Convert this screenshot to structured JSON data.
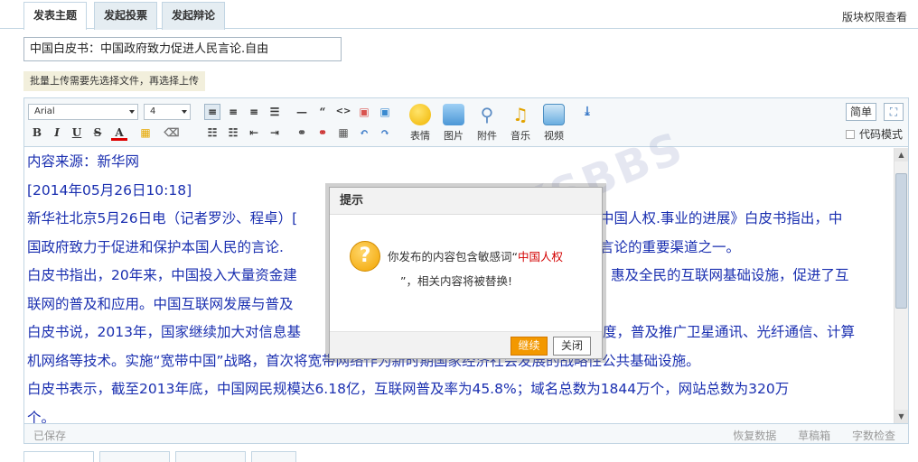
{
  "tabs": [
    {
      "label": "发表主题",
      "active": true
    },
    {
      "label": "发起投票",
      "active": false
    },
    {
      "label": "发起辩论",
      "active": false
    }
  ],
  "perm_link": "版块权限查看",
  "subject": {
    "value": "中国白皮书：中国政府致力促进人民言论.自由"
  },
  "upload_tip": "批量上传需要先选择文件，再选择上传",
  "toolbar": {
    "font_family": "Arial",
    "font_size": "4",
    "big_buttons": [
      "表情",
      "图片",
      "附件",
      "音乐",
      "视频"
    ],
    "simple_label": "简单",
    "code_mode_label": "代码模式"
  },
  "content_lines": [
    "内容来源：新华网",
    "[2014年05月26日10:18]",
    "新华社北京5月26日电（记者罗沙、程卓）[",
    "国政府致力于促进和保护本国人民的言论.",
    "白皮书指出，20年来，中国投入大量资金建",
    "联网的普及和应用。中国互联网发展与普及",
    "白皮书说，2013年，国家继续加大对信息基",
    "机网络等技术。实施“宽带中国”战略，首次将宽带网络作为新时期国家经济社会发展的战略性公共基础设施。",
    "白皮书表示，截至2013年底，中国网民规模达6.18亿，互联网普及率为45.8%；域名总数为1844万个，网站总数为320万",
    "个。"
  ],
  "content_right_fragments": [
    "中国人权.事业的进展》白皮书指出，中",
    "言论的重要渠道之一。",
    "惠及全民的互联网基础设施，促进了互",
    "",
    "度，普及推广卫星通讯、光纤通信、计算"
  ],
  "status": {
    "left": "已保存",
    "links": [
      "恢复数据",
      "草稿箱",
      "字数检查"
    ]
  },
  "watermark": "昆山论坛 KSBBS",
  "modal": {
    "title": "提示",
    "msg_before": "你发布的内容包含敏感词“",
    "keyword": "中国人权",
    "msg_after": "”，相关内容将被替换!",
    "continue_label": "继续",
    "close_label": "关闭"
  }
}
